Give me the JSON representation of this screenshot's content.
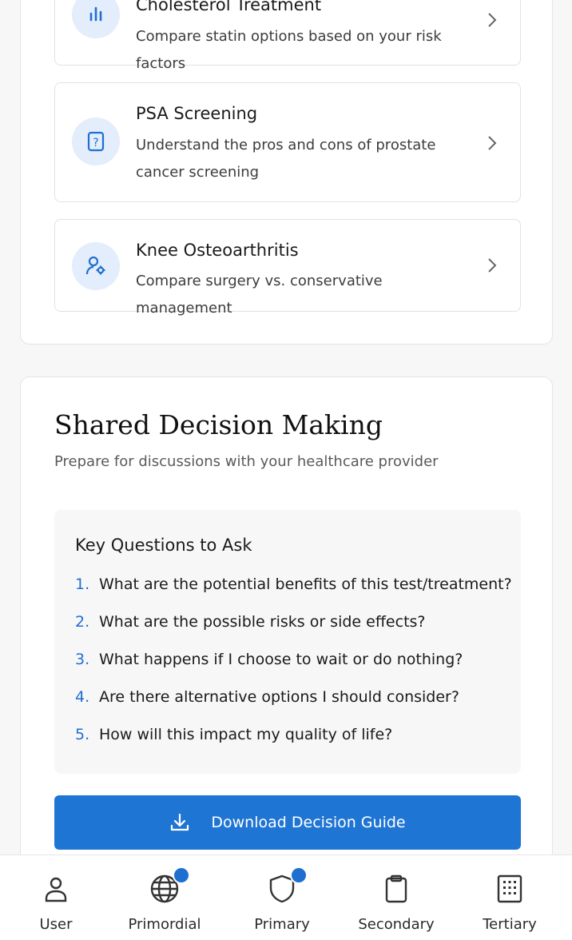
{
  "options": [
    {
      "title": "Cholesterol Treatment",
      "description": "Compare statin options based on your risk factors",
      "icon": "bar-chart-icon"
    },
    {
      "title": "PSA Screening",
      "description": "Understand the pros and cons of prostate cancer screening",
      "icon": "question-file-icon"
    },
    {
      "title": "Knee Osteoarthritis",
      "description": "Compare surgery vs. conservative management",
      "icon": "user-settings-icon"
    }
  ],
  "shared_decision": {
    "title": "Shared Decision Making",
    "subtitle": "Prepare for discussions with your healthcare provider",
    "key_questions": {
      "heading": "Key Questions to Ask",
      "items": [
        {
          "num": "1.",
          "text": "What are the potential benefits of this test/treatment?"
        },
        {
          "num": "2.",
          "text": "What are the possible risks or side effects?"
        },
        {
          "num": "3.",
          "text": "What happens if I choose to wait or do nothing?"
        },
        {
          "num": "4.",
          "text": "Are there alternative options I should consider?"
        },
        {
          "num": "5.",
          "text": "How will this impact my quality of life?"
        }
      ]
    },
    "download_label": "Download Decision Guide"
  },
  "nav": [
    {
      "label": "User",
      "icon": "user-icon",
      "badge": false
    },
    {
      "label": "Primordial",
      "icon": "globe-icon",
      "badge": true
    },
    {
      "label": "Primary",
      "icon": "shield-icon",
      "badge": true
    },
    {
      "label": "Secondary",
      "icon": "clipboard-icon",
      "badge": false
    },
    {
      "label": "Tertiary",
      "icon": "building-icon",
      "badge": false
    }
  ],
  "colors": {
    "accent": "#1f75d3",
    "icon_bg": "#e3edfb"
  }
}
